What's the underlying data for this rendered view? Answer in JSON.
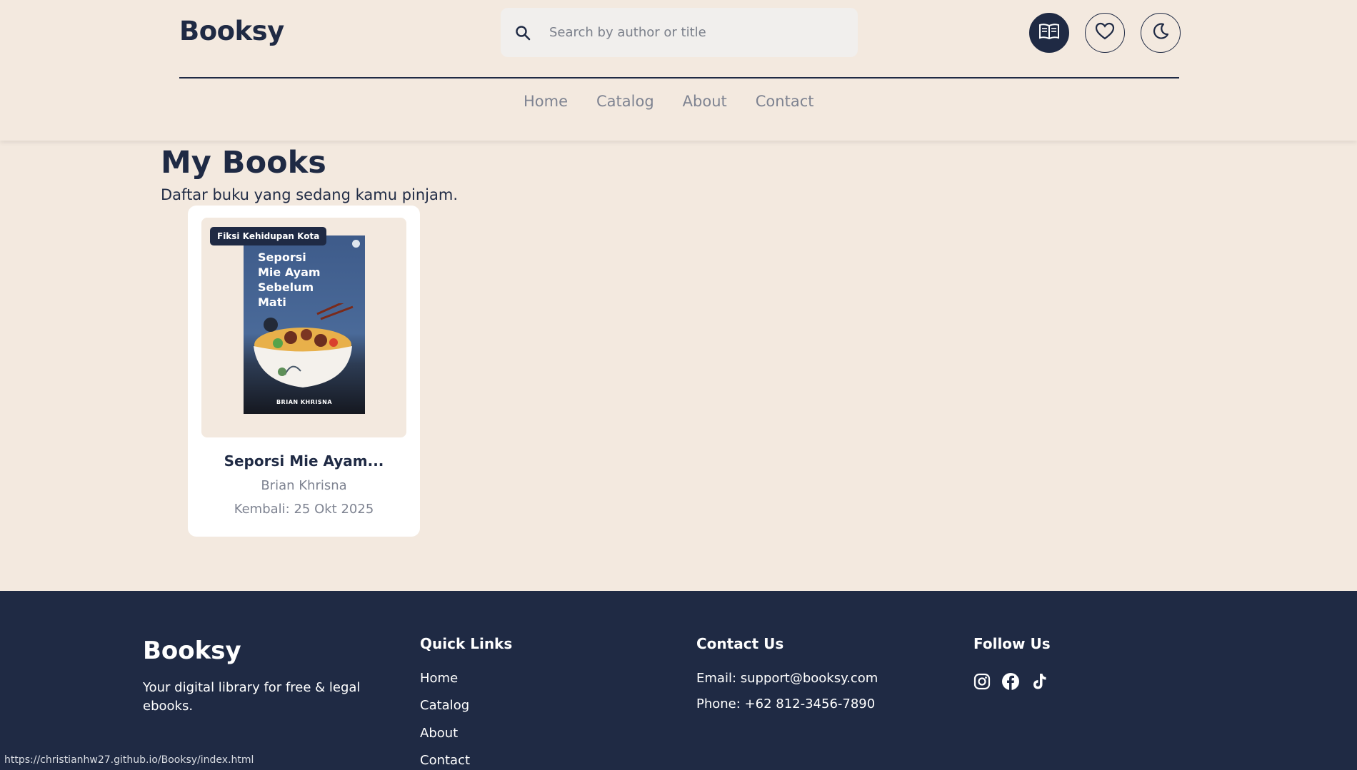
{
  "header": {
    "logo": "Booksy",
    "search_placeholder": "Search by author or title",
    "icons": [
      "my-books-icon",
      "heart-icon",
      "moon-icon"
    ]
  },
  "nav": {
    "items": [
      "Home",
      "Catalog",
      "About",
      "Contact"
    ]
  },
  "main": {
    "title": "My Books",
    "subtitle": "Daftar buku yang sedang kamu pinjam."
  },
  "books": [
    {
      "badge": "Fiksi Kehidupan Kota",
      "cover_title": "Seporsi Mie Ayam Sebelum Mati",
      "cover_author": "BRIAN KHRISNA",
      "title": "Seporsi Mie Ayam...",
      "author": "Brian Khrisna",
      "due": "Kembali: 25 Okt 2025"
    }
  ],
  "footer": {
    "logo": "Booksy",
    "tagline": "Your digital library for free & legal ebooks.",
    "quick_links_title": "Quick Links",
    "quick_links": [
      "Home",
      "Catalog",
      "About",
      "Contact"
    ],
    "contact_title": "Contact Us",
    "email": "Email: support@booksy.com",
    "phone": "Phone: +62 812-3456-7890",
    "follow_title": "Follow Us",
    "social": [
      "instagram-icon",
      "facebook-icon",
      "tiktok-icon"
    ]
  },
  "status_bar": {
    "url": "https://christianhw27.github.io/Booksy/index.html"
  },
  "colors": {
    "background": "#f3e9df",
    "navy": "#1f2a44",
    "muted": "#7e8391",
    "card": "#ffffff"
  }
}
